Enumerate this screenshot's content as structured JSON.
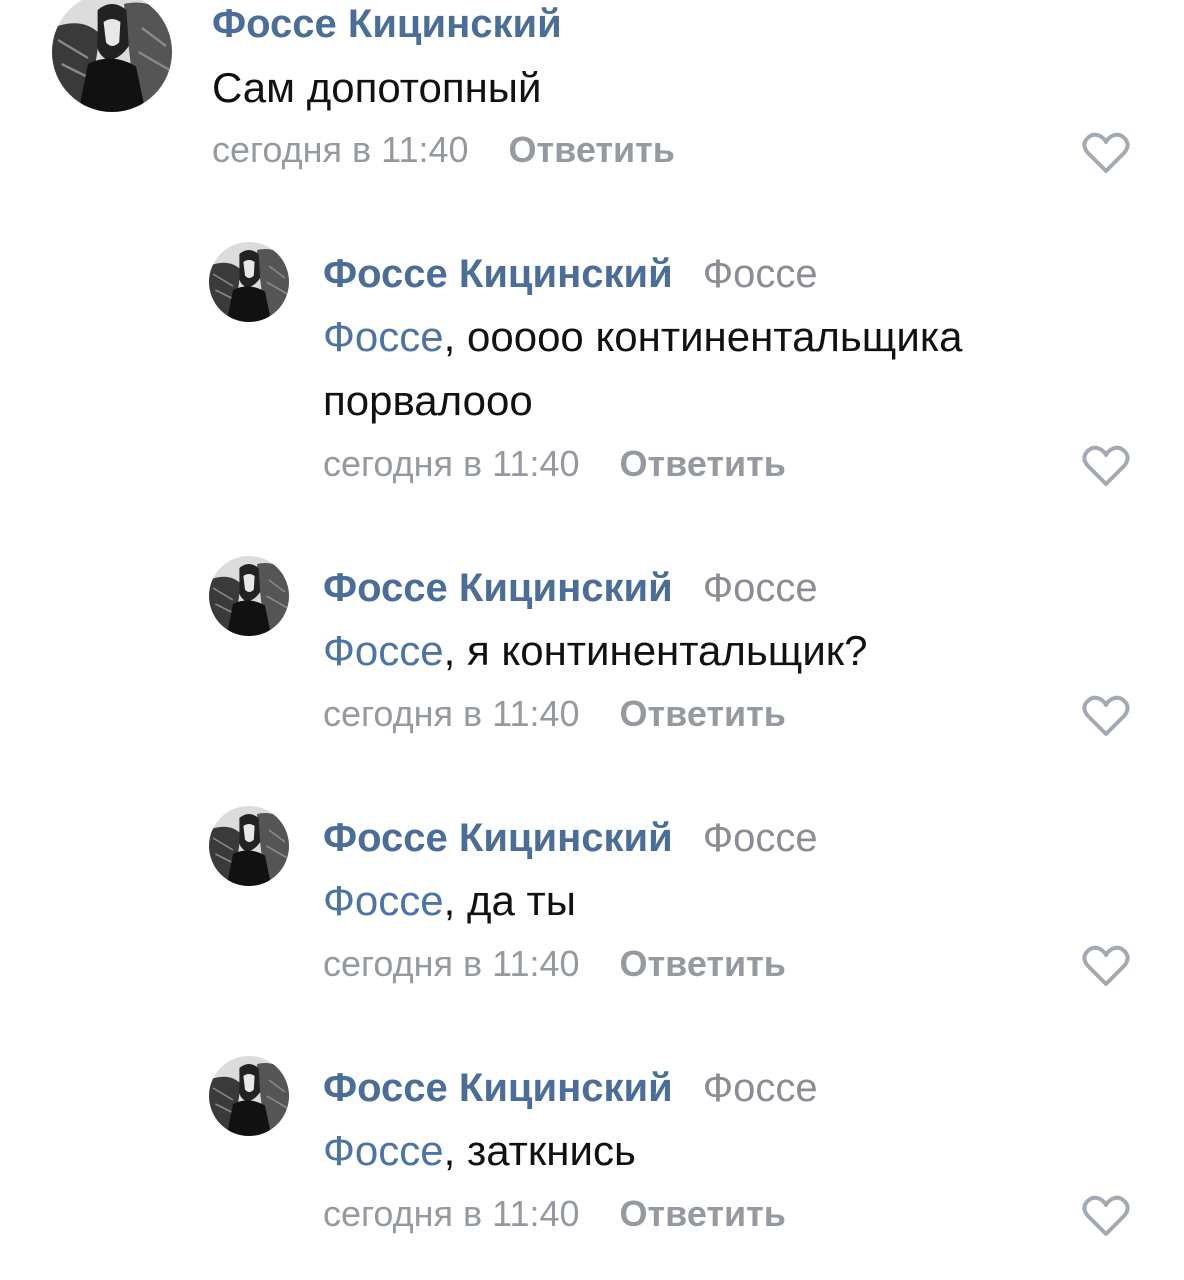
{
  "comments": [
    {
      "author": "Фоссе Кицинский",
      "reply_to": "",
      "mention": "",
      "text": "Сам допотопный",
      "time": "сегодня в 11:40",
      "reply_label": "Ответить"
    },
    {
      "author": "Фоссе Кицинский",
      "reply_to": "Фоссе",
      "mention": "Фоссе",
      "text_line1": ", ооооо континентальщика",
      "text_line2": "порвалооо",
      "time": "сегодня в 11:40",
      "reply_label": "Ответить"
    },
    {
      "author": "Фоссе Кицинский",
      "reply_to": "Фоссе",
      "mention": "Фоссе",
      "text": ", я континентальщик?",
      "time": "сегодня в 11:40",
      "reply_label": "Ответить"
    },
    {
      "author": "Фоссе Кицинский",
      "reply_to": "Фоссе",
      "mention": "Фоссе",
      "text": ", да ты",
      "time": "сегодня в 11:40",
      "reply_label": "Ответить"
    },
    {
      "author": "Фоссе Кицинский",
      "reply_to": "Фоссе",
      "mention": "Фоссе",
      "text": ", заткнись",
      "time": "сегодня в 11:40",
      "reply_label": "Ответить"
    }
  ],
  "icons": {
    "like": "heart-outline-icon",
    "avatar": "ink-drawing-portrait"
  },
  "colors": {
    "author": "#4a6d99",
    "mention": "#4d74a6",
    "meta": "#959aa0",
    "text": "#111111",
    "like": "#a3aab3"
  }
}
